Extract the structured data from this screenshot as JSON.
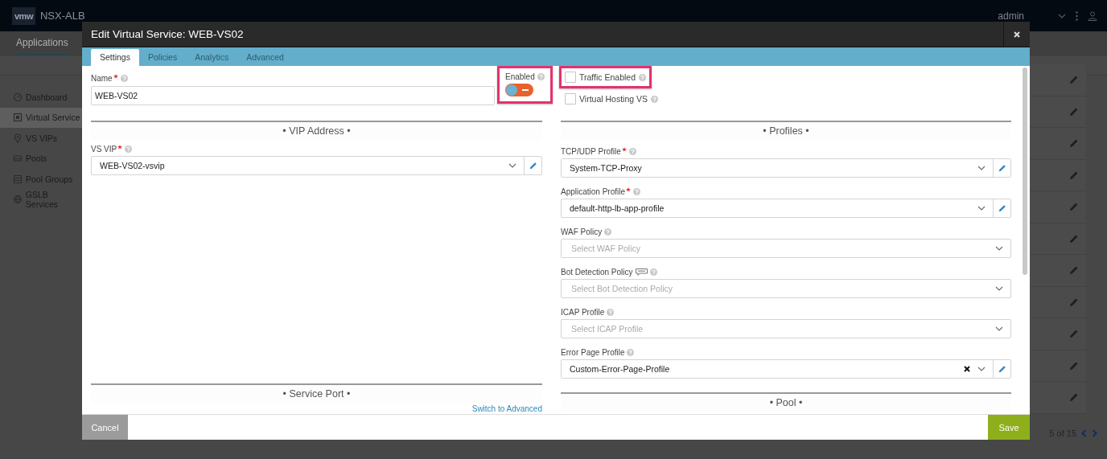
{
  "app": {
    "logo": "vmw",
    "product": "NSX-ALB",
    "user": "admin",
    "nav_tabs": [
      {
        "label": "Applications",
        "selected": true
      }
    ],
    "sidebar": [
      {
        "label": "Dashboard",
        "selected": false
      },
      {
        "label": "Virtual Service",
        "selected": true
      },
      {
        "label": "VS VIPs",
        "selected": false
      },
      {
        "label": "Pools",
        "selected": false
      },
      {
        "label": "Pool Groups",
        "selected": false
      },
      {
        "label": "GSLB Services",
        "selected": false
      }
    ],
    "pager": "5 of 15"
  },
  "modal": {
    "title": "Edit Virtual Service: WEB-VS02",
    "tabs": [
      {
        "label": "Settings",
        "selected": true
      },
      {
        "label": "Policies",
        "selected": false
      },
      {
        "label": "Analytics",
        "selected": false
      },
      {
        "label": "Advanced",
        "selected": false
      }
    ],
    "name_field": {
      "label": "Name",
      "required": true,
      "value": "WEB-VS02"
    },
    "enabled": {
      "label": "Enabled",
      "on": false,
      "highlighted": true
    },
    "checkboxes": [
      {
        "label": "Traffic Enabled",
        "checked": false,
        "highlighted": true
      },
      {
        "label": "Virtual Hosting VS",
        "checked": false,
        "highlighted": false
      }
    ],
    "vip_section": {
      "title": "• VIP Address •",
      "fields": [
        {
          "label": "VS VIP",
          "required": true,
          "beta": false,
          "value": "WEB-VS02-vsvip",
          "editable": true,
          "clearable": false
        }
      ]
    },
    "profiles_section": {
      "title": "• Profiles •",
      "fields": [
        {
          "label": "TCP/UDP Profile",
          "required": true,
          "beta": false,
          "value": "System-TCP-Proxy",
          "editable": true,
          "clearable": false
        },
        {
          "label": "Application Profile",
          "required": true,
          "beta": false,
          "value": "default-http-lb-app-profile",
          "editable": true,
          "clearable": false
        },
        {
          "label": "WAF Policy",
          "required": false,
          "beta": false,
          "placeholder": "Select WAF Policy",
          "editable": false,
          "clearable": false
        },
        {
          "label": "Bot Detection Policy",
          "required": false,
          "beta": true,
          "placeholder": "Select Bot Detection Policy",
          "editable": false,
          "clearable": false
        },
        {
          "label": "ICAP Profile",
          "required": false,
          "beta": false,
          "placeholder": "Select ICAP Profile",
          "editable": false,
          "clearable": false
        },
        {
          "label": "Error Page Profile",
          "required": false,
          "beta": false,
          "value": "Custom-Error-Page-Profile",
          "editable": true,
          "clearable": true
        }
      ]
    },
    "service_port_section": {
      "title": "• Service Port •",
      "link": "Switch to Advanced"
    },
    "pool_section": {
      "title": "• Pool •"
    },
    "cancel": "Cancel",
    "save": "Save"
  }
}
